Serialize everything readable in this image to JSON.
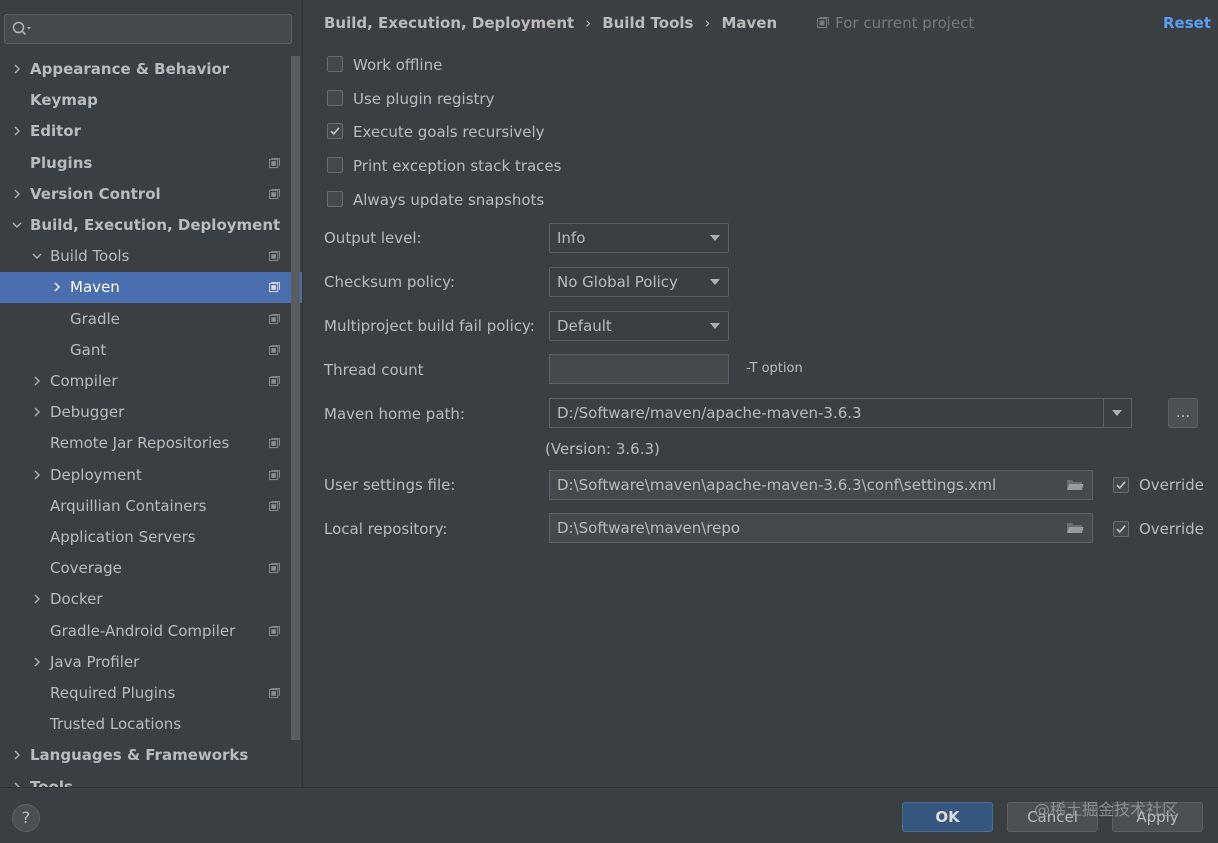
{
  "search": {
    "value": "",
    "placeholder": ""
  },
  "sidebar": {
    "items": [
      {
        "label": "Appearance & Behavior",
        "bold": true,
        "level": 0,
        "arrow": "right",
        "project": false
      },
      {
        "label": "Keymap",
        "bold": true,
        "level": 0,
        "arrow": "none",
        "project": false
      },
      {
        "label": "Editor",
        "bold": true,
        "level": 0,
        "arrow": "right",
        "project": false
      },
      {
        "label": "Plugins",
        "bold": true,
        "level": 0,
        "arrow": "none",
        "project": true
      },
      {
        "label": "Version Control",
        "bold": true,
        "level": 0,
        "arrow": "right",
        "project": true
      },
      {
        "label": "Build, Execution, Deployment",
        "bold": true,
        "level": 0,
        "arrow": "down",
        "project": false
      },
      {
        "label": "Build Tools",
        "bold": false,
        "level": 1,
        "arrow": "down",
        "project": true
      },
      {
        "label": "Maven",
        "bold": false,
        "level": 2,
        "arrow": "right",
        "project": true,
        "selected": true
      },
      {
        "label": "Gradle",
        "bold": false,
        "level": 2,
        "arrow": "none",
        "project": true
      },
      {
        "label": "Gant",
        "bold": false,
        "level": 2,
        "arrow": "none",
        "project": true
      },
      {
        "label": "Compiler",
        "bold": false,
        "level": 1,
        "arrow": "right",
        "project": true
      },
      {
        "label": "Debugger",
        "bold": false,
        "level": 1,
        "arrow": "right",
        "project": false
      },
      {
        "label": "Remote Jar Repositories",
        "bold": false,
        "level": 1,
        "arrow": "none",
        "project": true
      },
      {
        "label": "Deployment",
        "bold": false,
        "level": 1,
        "arrow": "right",
        "project": true
      },
      {
        "label": "Arquillian Containers",
        "bold": false,
        "level": 1,
        "arrow": "none",
        "project": true
      },
      {
        "label": "Application Servers",
        "bold": false,
        "level": 1,
        "arrow": "none",
        "project": false
      },
      {
        "label": "Coverage",
        "bold": false,
        "level": 1,
        "arrow": "none",
        "project": true
      },
      {
        "label": "Docker",
        "bold": false,
        "level": 1,
        "arrow": "right",
        "project": false
      },
      {
        "label": "Gradle-Android Compiler",
        "bold": false,
        "level": 1,
        "arrow": "none",
        "project": true
      },
      {
        "label": "Java Profiler",
        "bold": false,
        "level": 1,
        "arrow": "right",
        "project": false
      },
      {
        "label": "Required Plugins",
        "bold": false,
        "level": 1,
        "arrow": "none",
        "project": true
      },
      {
        "label": "Trusted Locations",
        "bold": false,
        "level": 1,
        "arrow": "none",
        "project": false
      },
      {
        "label": "Languages & Frameworks",
        "bold": true,
        "level": 0,
        "arrow": "right",
        "project": false
      },
      {
        "label": "Tools",
        "bold": true,
        "level": 0,
        "arrow": "right",
        "project": false
      }
    ]
  },
  "breadcrumb": {
    "items": [
      "Build, Execution, Deployment",
      "Build Tools",
      "Maven"
    ],
    "separator": "›",
    "scope": "For current project",
    "reset": "Reset"
  },
  "options": [
    {
      "label": "Work offline",
      "checked": false
    },
    {
      "label": "Use plugin registry",
      "checked": false
    },
    {
      "label": "Execute goals recursively",
      "checked": true
    },
    {
      "label": "Print exception stack traces",
      "checked": false
    },
    {
      "label": "Always update snapshots",
      "checked": false
    }
  ],
  "fields": {
    "output_level": {
      "label": "Output level:",
      "value": "Info"
    },
    "checksum_policy": {
      "label": "Checksum policy:",
      "value": "No Global Policy"
    },
    "fail_policy": {
      "label": "Multiproject build fail policy:",
      "value": "Default"
    },
    "thread_count": {
      "label": "Thread count",
      "value": "",
      "hint": "-T option"
    },
    "maven_home": {
      "label": "Maven home path:",
      "value": "D:/Software/maven/apache-maven-3.6.3",
      "browse": "...",
      "version": "(Version: 3.6.3)"
    },
    "user_settings": {
      "label": "User settings file:",
      "value": "D:\\Software\\maven\\apache-maven-3.6.3\\conf\\settings.xml",
      "override": "Override",
      "override_checked": true
    },
    "local_repo": {
      "label": "Local repository:",
      "value": "D:\\Software\\maven\\repo",
      "override": "Override",
      "override_checked": true
    }
  },
  "footer": {
    "help": "?",
    "ok": "OK",
    "cancel": "Cancel",
    "apply": "Apply",
    "watermark": "@稀土掘金技术社区"
  },
  "colors": {
    "background": "#3c3f41",
    "selection": "#4b6eaf",
    "link": "#589df6",
    "default_button": "#365880"
  }
}
